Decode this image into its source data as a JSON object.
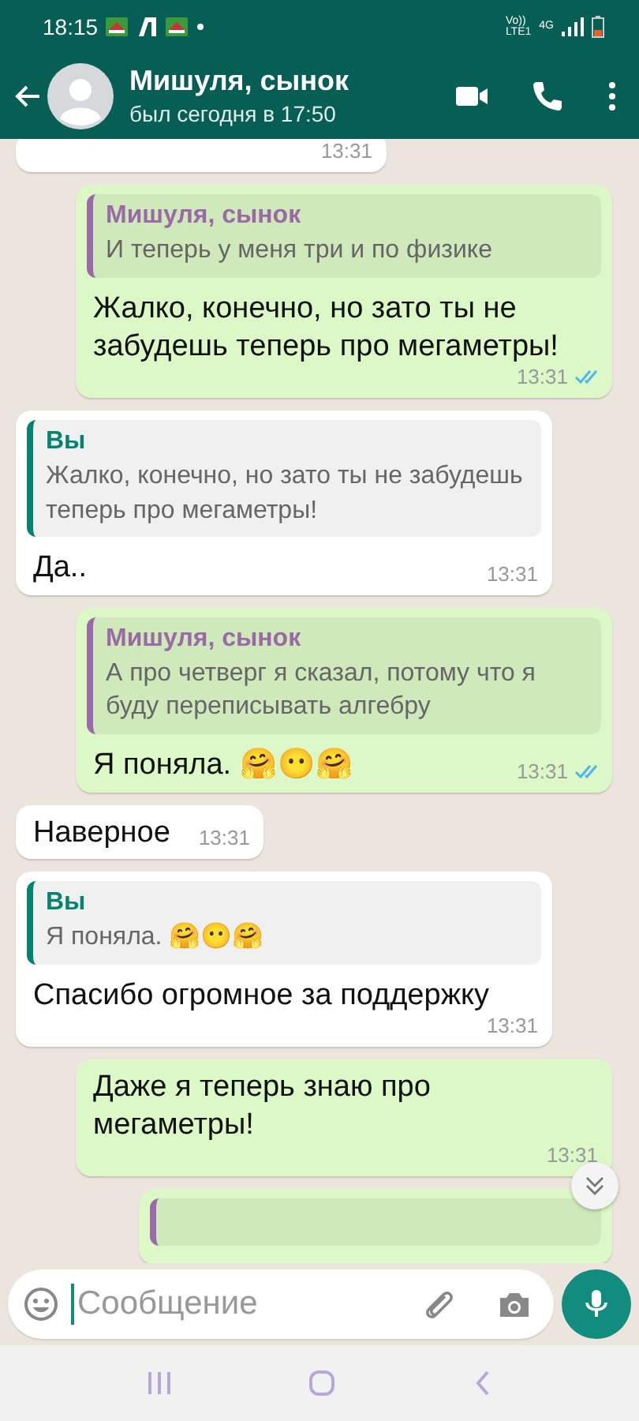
{
  "status_bar": {
    "time": "18:15",
    "network": [
      "Vo))",
      "LTE1",
      "4G"
    ]
  },
  "header": {
    "name": "Мишуля, сынок",
    "last_seen": "был сегодня в 17:50"
  },
  "messages": [
    {
      "outgoing": false,
      "time": "13:31"
    },
    {
      "outgoing": true,
      "quote": {
        "author": "Мишуля, сынок",
        "from_me": false,
        "text": "И теперь у меня три и по физике"
      },
      "text": "Жалко, конечно, но зато ты не забудешь теперь про мегаметры!",
      "time": "13:31",
      "read": true
    },
    {
      "outgoing": false,
      "quote": {
        "author": "Вы",
        "from_me": true,
        "text": "Жалко, конечно, но зато ты не забудешь теперь про мегаметры!"
      },
      "text": "Да..",
      "time": "13:31"
    },
    {
      "outgoing": true,
      "quote": {
        "author": "Мишуля, сынок",
        "from_me": false,
        "text": "А про четверг я сказал, потому что я буду переписывать алгебру"
      },
      "text": "Я поняла. 🤗😶🤗",
      "time": "13:31",
      "read": true
    },
    {
      "outgoing": false,
      "text": "Наверное",
      "time": "13:31"
    },
    {
      "outgoing": false,
      "quote": {
        "author": "Вы",
        "from_me": true,
        "text": "Я поняла. 🤗😶🤗"
      },
      "text": "Спасибо огромное за поддержку",
      "time": "13:31"
    },
    {
      "outgoing": true,
      "text": "Даже я теперь знаю про мегаметры!",
      "time": "13:31"
    },
    {
      "outgoing": true,
      "quote": {
        "from_me": false
      }
    }
  ],
  "composer": {
    "placeholder": "Сообщение"
  }
}
